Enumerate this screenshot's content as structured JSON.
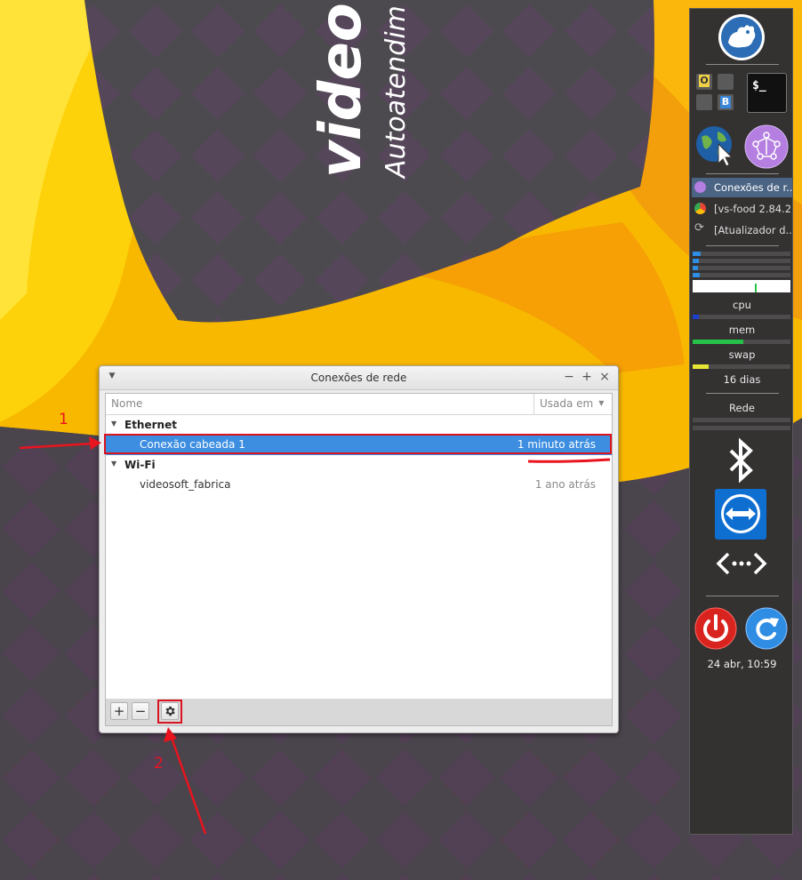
{
  "wallpaper": {
    "brand_text": "video",
    "brand_subtext": "Autoatendim"
  },
  "window": {
    "title": "Conexões de rede",
    "menu_icon": "triangle-down",
    "controls": {
      "minimize": "−",
      "maximize": "+",
      "close": "×"
    },
    "columns": {
      "name": "Nome",
      "used": "Usada em"
    },
    "groups": [
      {
        "label": "Ethernet",
        "connections": [
          {
            "name": "Conexão cabeada 1",
            "used": "1 minuto atrás",
            "selected": true
          }
        ]
      },
      {
        "label": "Wi-Fi",
        "connections": [
          {
            "name": "videosoft_fabrica",
            "used": "1 ano atrás",
            "selected": false
          }
        ]
      }
    ],
    "toolbar": {
      "add_label": "+",
      "remove_label": "−",
      "settings_icon": "gear-icon"
    }
  },
  "annotations": {
    "label_1": "1",
    "label_2": "2",
    "color": "#e8141e"
  },
  "dock": {
    "tasks": [
      {
        "label": "Conexões de r...",
        "icon": "network-globe-icon",
        "active": true
      },
      {
        "label": "[vs-food 2.84.2...",
        "icon": "chrome-icon",
        "active": false
      },
      {
        "label": "[Atualizador d...",
        "icon": "refresh-icon",
        "active": false
      }
    ],
    "monitors": {
      "cpu_label": "cpu",
      "cpu_fraction": 0.06,
      "mem_label": "mem",
      "mem_fraction": 0.52,
      "swap_label": "swap",
      "swap_fraction": 0.16,
      "uptime": "16 dias",
      "network_label": "Rede"
    },
    "terminal_glyph": "$_",
    "workspace_letters": [
      "O",
      "B"
    ],
    "clock": "24 abr, 10:59"
  },
  "colors": {
    "accent_selection": "#3d8ee1",
    "annotation_red": "#e8141e",
    "dock_bg": "#343131"
  }
}
